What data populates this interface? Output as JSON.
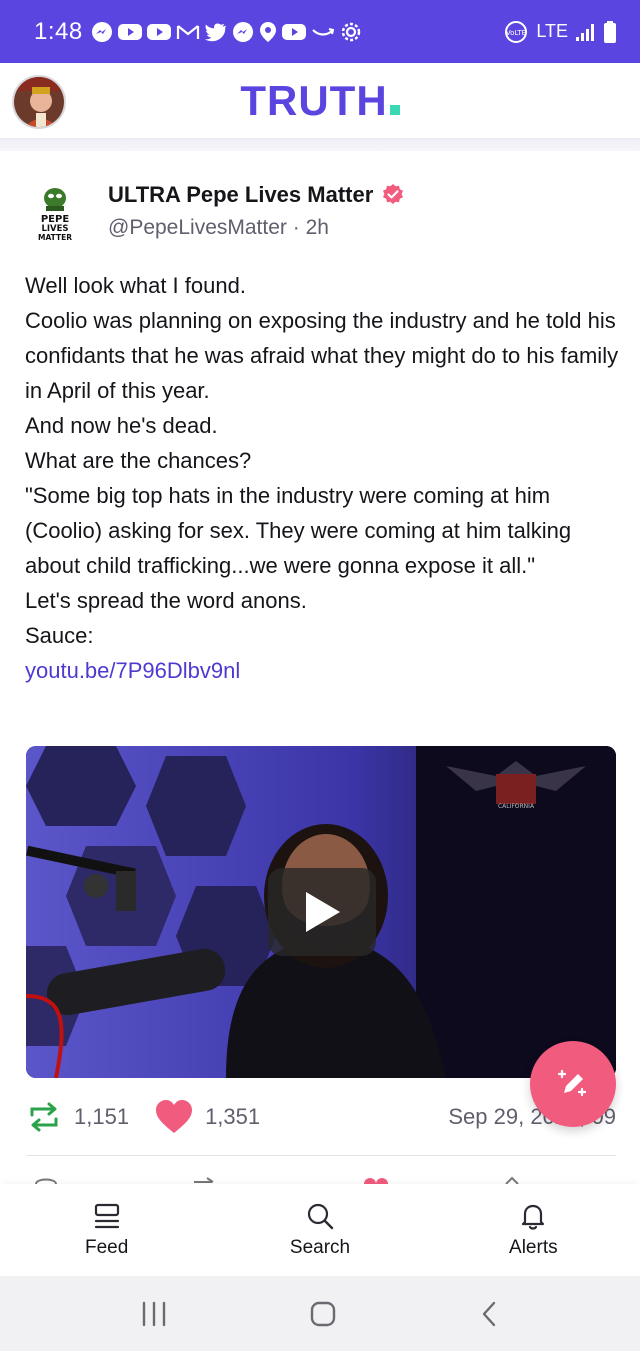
{
  "status_bar": {
    "time": "1:48",
    "network": "LTE",
    "volte": "VoLTE"
  },
  "header": {
    "logo_text": "TRUTH",
    "logo_dot_color": "#3ad9b6",
    "brand_color": "#5a45e0"
  },
  "post": {
    "author_name": "ULTRA Pepe Lives Matter",
    "author_handle": "@PepeLivesMatter",
    "separator": "·",
    "time_ago": "2h",
    "avatar_text": [
      "PEPE",
      "LIVES",
      "MATTER"
    ],
    "lines": [
      "Well look what I found.",
      "Coolio was planning on exposing the industry and he told his confidants that he was afraid what they might do to his family in April of this year.",
      "And now he's dead.",
      "What are the chances?",
      "\"Some big top hats in the industry were coming at him (Coolio) asking for sex. They were coming at him talking about child trafficking...we were gonna expose it all.\"",
      "Let's spread the word anons.",
      "Sauce:"
    ],
    "link": "youtu.be/7P96Dlbv9nl",
    "video_badge": "CALIFORNIA"
  },
  "stats": {
    "retruths": "1,151",
    "likes": "1,351",
    "date": "Sep 29, 2022,",
    "time_partial": "09"
  },
  "bottom_nav": {
    "feed": "Feed",
    "search": "Search",
    "alerts": "Alerts"
  },
  "colors": {
    "accent": "#5a45e0",
    "link": "#4d3ad1",
    "like": "#f15b7e",
    "retruth": "#2aa34a",
    "fab": "#f15b7e"
  }
}
